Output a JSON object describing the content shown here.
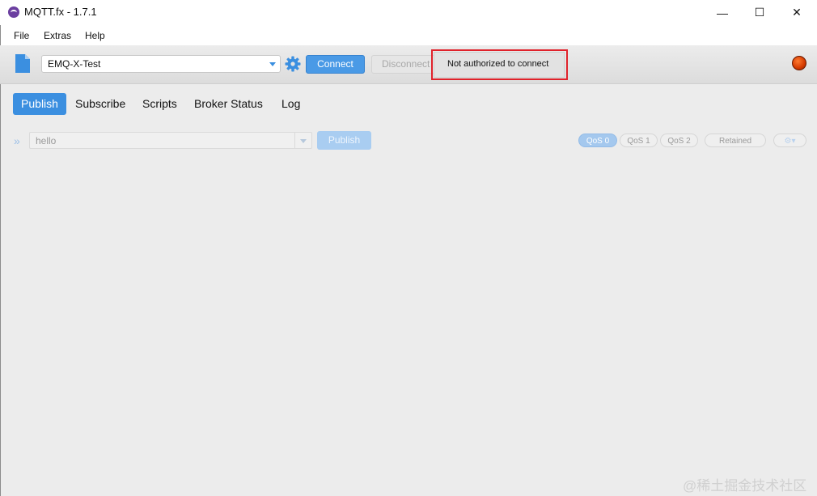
{
  "window": {
    "title": "MQTT.fx - 1.7.1",
    "minimize_glyph": "—",
    "maximize_glyph": "☐",
    "close_glyph": "✕"
  },
  "menu": {
    "items": [
      "File",
      "Extras",
      "Help"
    ]
  },
  "toolbar": {
    "profile_value": "EMQ-X-Test",
    "connect_label": "Connect",
    "disconnect_label": "Disconnect",
    "tooltip_text": "Not authorized to connect",
    "status_color": "#d43a00"
  },
  "tabs": [
    "Publish",
    "Subscribe",
    "Scripts",
    "Broker Status",
    "Log"
  ],
  "publish": {
    "topic_value": "hello",
    "publish_label": "Publish",
    "qos_options": [
      "QoS 0",
      "QoS 1",
      "QoS 2"
    ],
    "selected_qos": "QoS 0",
    "retained_label": "Retained",
    "settings_glyph": "⚙▾"
  },
  "watermark": "@稀土掘金技术社区",
  "colors": {
    "accent": "#3b8fe0",
    "alert_border": "#e0222b"
  }
}
